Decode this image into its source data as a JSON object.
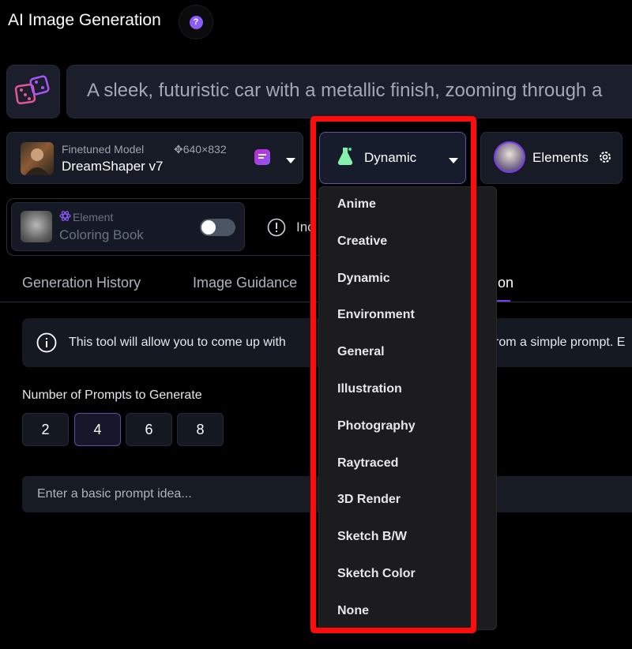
{
  "header": {
    "title": "AI Image Generation",
    "help_label": "?"
  },
  "prompt": {
    "text": "A sleek, futuristic car with a metallic finish, zooming through a"
  },
  "model": {
    "kind": "Finetuned Model",
    "name": "DreamShaper v7",
    "size": "640×832"
  },
  "style": {
    "selected": "Dynamic",
    "options": [
      "Anime",
      "Creative",
      "Dynamic",
      "Environment",
      "General",
      "Illustration",
      "Photography",
      "Raytraced",
      "3D Render",
      "Sketch B/W",
      "Sketch Color",
      "None"
    ]
  },
  "elements": {
    "label": "Elements"
  },
  "element": {
    "tag": "Element",
    "name": "Coloring Book",
    "enabled": false,
    "include_partial": "Inc"
  },
  "tabs": {
    "history": "Generation History",
    "guidance": "Image Guidance",
    "active_tail": "on"
  },
  "info": {
    "text": "This tool will allow you to come up with",
    "text_tail": "rom a simple prompt. E"
  },
  "num_prompts": {
    "label": "Number of Prompts to Generate",
    "options": [
      "2",
      "4",
      "6",
      "8"
    ],
    "selected": "4"
  },
  "basic_prompt": {
    "placeholder": "Enter a basic prompt idea..."
  },
  "colors": {
    "accent": "#7c3aed",
    "highlight_box": "#ff0b0b",
    "background": "#000000"
  }
}
